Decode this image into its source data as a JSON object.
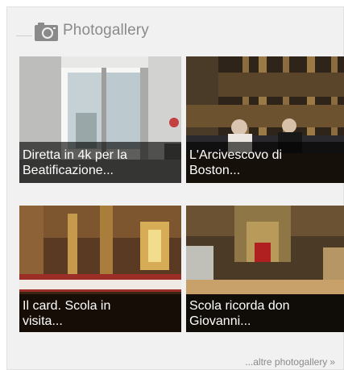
{
  "widget": {
    "title": "Photogallery",
    "icon": "camera-icon",
    "more_link": "...altre photogallery",
    "more_arrow": "»"
  },
  "gallery": [
    {
      "line1": "Diretta in 4k per la",
      "line2": "Beatificazione..."
    },
    {
      "line1": "L'Arcivescovo di",
      "line2": "Boston..."
    },
    {
      "line1": "Il card. Scola in",
      "line2": "visita..."
    },
    {
      "line1": "Scola ricorda don",
      "line2": "Giovanni..."
    }
  ],
  "colors": {
    "panel_bg": "#f1f1f1",
    "title_text": "#8a8a8a",
    "caption_bg": "rgba(0,0,0,0.62)",
    "caption_text": "#ffffff"
  }
}
